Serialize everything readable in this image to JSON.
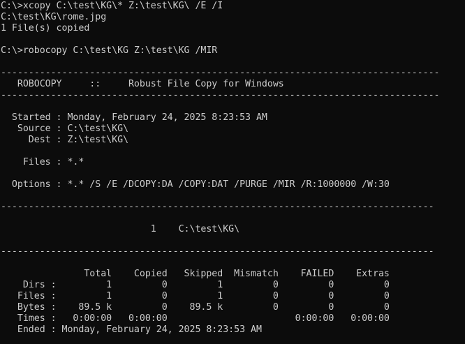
{
  "console": {
    "lines": [
      "C:\\>xcopy C:\\test\\KG\\* Z:\\test\\KG\\ /E /I",
      "C:\\test\\KG\\rome.jpg",
      "1 File(s) copied",
      "",
      "C:\\>robocopy C:\\test\\KG Z:\\test\\KG /MIR",
      "",
      "-------------------------------------------------------------------------------",
      "   ROBOCOPY     ::     Robust File Copy for Windows",
      "-------------------------------------------------------------------------------",
      "",
      "  Started : Monday, February 24, 2025 8:23:53 AM",
      "   Source : C:\\test\\KG\\",
      "     Dest : Z:\\test\\KG\\",
      "",
      "    Files : *.*",
      "",
      "  Options : *.* /S /E /DCOPY:DA /COPY:DAT /PURGE /MIR /R:1000000 /W:30",
      "",
      "------------------------------------------------------------------------------",
      "",
      "                           1    C:\\test\\KG\\",
      "",
      "------------------------------------------------------------------------------",
      "",
      "               Total    Copied   Skipped  Mismatch    FAILED    Extras",
      "    Dirs :         1         0         1         0         0         0",
      "   Files :         1         0         1         0         0         0",
      "   Bytes :    89.5 k         0    89.5 k         0         0         0",
      "   Times :   0:00:00   0:00:00                       0:00:00   0:00:00",
      "   Ended : Monday, February 24, 2025 8:23:53 AM"
    ]
  }
}
